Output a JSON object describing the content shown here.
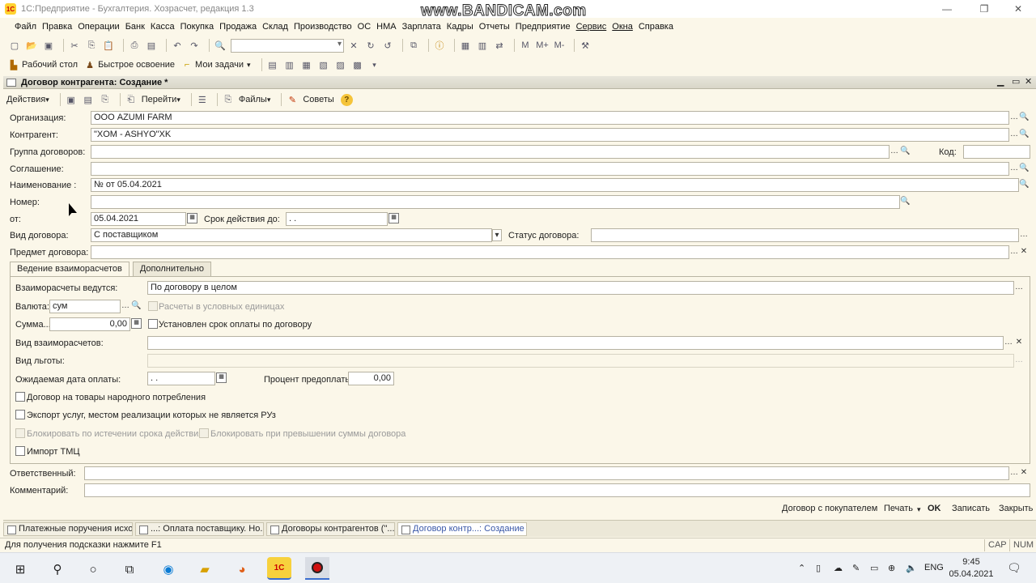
{
  "window": {
    "title": "1С:Предприятие - Бухгалтерия. Хозрасчет, редакция 1.3",
    "watermark": "www.BANDICAM.com"
  },
  "menu": [
    "Файл",
    "Правка",
    "Операции",
    "Банк",
    "Касса",
    "Покупка",
    "Продажа",
    "Склад",
    "Производство",
    "ОС",
    "НМА",
    "Зарплата",
    "Кадры",
    "Отчеты",
    "Предприятие",
    "Сервис",
    "Окна",
    "Справка"
  ],
  "toolbar2": {
    "desktop": "Рабочий стол",
    "quick": "Быстрое освоение",
    "tasks": "Мои задачи"
  },
  "doc": {
    "title": "Договор контрагента: Создание *"
  },
  "actions": {
    "actions": "Действия",
    "goto": "Перейти",
    "files": "Файлы",
    "tips": "Советы",
    "help": "?"
  },
  "form": {
    "org_label": "Организация:",
    "org_value": "ООО AZUMI FARM",
    "contr_label": "Контрагент:",
    "contr_value": "\"XOM - ASHYO\"XK",
    "group_label": "Группа договоров:",
    "group_value": "",
    "code_label": "Код:",
    "code_value": "",
    "agreement_label": "Соглашение:",
    "agreement_value": "",
    "name_label": "Наименование :",
    "name_value": "№  от 05.04.2021",
    "number_label": "Номер:",
    "number_value": "",
    "from_label": "от:",
    "from_value": "05.04.2021",
    "validity_label": "Срок действия до:",
    "validity_value": "  .  .",
    "kind_label": "Вид договора:",
    "kind_value": "С поставщиком",
    "status_label": "Статус договора:",
    "status_value": "",
    "subject_label": "Предмет договора:",
    "subject_value": ""
  },
  "tabs": [
    "Ведение взаиморасчетов",
    "Дополнительно"
  ],
  "panel": {
    "settle_label": "Взаиморасчеты ведутся:",
    "settle_value": "По договору в целом",
    "currency_label": "Валюта:",
    "currency_value": "сум",
    "conventional_label": "Расчеты в условных единицах",
    "sum_label": "Сумма...",
    "sum_value": "0,00",
    "term_label": "Установлен срок оплаты по договору",
    "settle_kind_label": "Вид взаиморасчетов:",
    "settle_kind_value": "",
    "benefit_label": "Вид льготы:",
    "benefit_value": "",
    "exp_date_label": "Ожидаемая дата оплаты:",
    "exp_date_value": "  .  .",
    "prepay_label": "Процент предоплаты:",
    "prepay_value": "0,00",
    "consumer_goods_label": "Договор на товары народного потребления",
    "export_label": "Экспорт услуг, местом реализации которых не является РУз",
    "block_expiry_label": "Блокировать по истечении срока действия",
    "block_sum_label": "Блокировать при превышении суммы договора",
    "import_label": "Импорт ТМЦ"
  },
  "bottom": {
    "resp_label": "Ответственный:",
    "resp_value": "",
    "comment_label": "Комментарий:",
    "comment_value": ""
  },
  "commands": {
    "buyer_contract": "Договор с покупателем",
    "print": "Печать",
    "ok": "OK",
    "save": "Записать",
    "close": "Закрыть"
  },
  "window_tabs": [
    "Платежные поручения исхо...",
    "...: Оплата поставщику. Но...",
    "Договоры контрагентов (\"...",
    "Договор контр...: Создание *"
  ],
  "status": {
    "hint": "Для получения подсказки нажмите F1",
    "cap": "CAP",
    "num": "NUM"
  },
  "win_taskbar": {
    "lang": "ENG",
    "time": "9:45",
    "date": "05.04.2021",
    "app_1c": "1С"
  }
}
